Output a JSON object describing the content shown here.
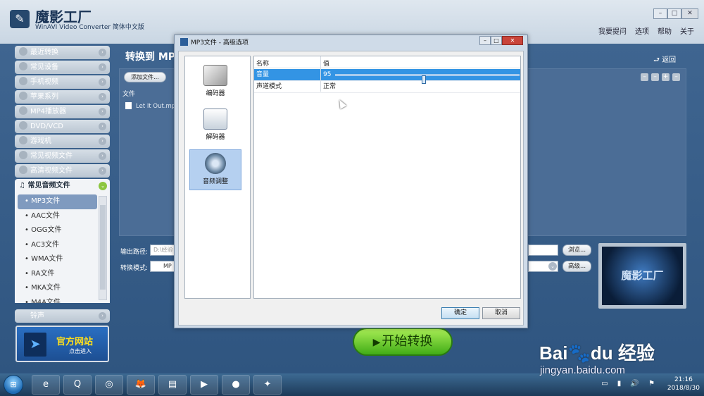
{
  "app": {
    "title": "魔影工厂",
    "subtitle": "WinAVI Video Converter 简体中文版",
    "window_buttons": [
      "–",
      "□",
      "✕"
    ],
    "top_links": [
      "我要提问",
      "选项",
      "帮助",
      "关于"
    ]
  },
  "sidebar": {
    "items": [
      {
        "label": "最近转换"
      },
      {
        "label": "常见设备"
      },
      {
        "label": "手机视频"
      },
      {
        "label": "苹果系列"
      },
      {
        "label": "MP4播放器"
      },
      {
        "label": "DVD/VCD"
      },
      {
        "label": "游戏机"
      },
      {
        "label": "常见视频文件"
      },
      {
        "label": "高清视频文件"
      }
    ],
    "open_category": "常见音频文件",
    "sub_items": [
      "• MP3文件",
      "• AAC文件",
      "• OGG文件",
      "• AC3文件",
      "• WMA文件",
      "• RA文件",
      "• MKA文件",
      "• M4A文件"
    ],
    "selected_sub_index": 0,
    "ring_label": "铃声",
    "official": {
      "title": "官方网站",
      "subtitle": "点击进入"
    }
  },
  "main": {
    "title": "转换到 MP",
    "back_label": "返回",
    "add_file_label": "添加文件...",
    "file_column": "文件",
    "file_name": "Let It Out.mp",
    "mini_buttons": [
      "–",
      "–",
      "+",
      "–"
    ],
    "output_label": "输出路径:",
    "output_value": "D:\\经验",
    "mode_label": "转换模式:",
    "mode_value": "MP",
    "browse_label": "浏览...",
    "advanced_label": "高级...",
    "preview_logo": "魔影工厂",
    "start_label": "开始转换"
  },
  "dialog": {
    "title": "MP3文件 - 高级选项",
    "title_buttons": [
      "–",
      "□",
      "✕"
    ],
    "left_items": [
      {
        "label": "编码器",
        "icon": "encoder-icon"
      },
      {
        "label": "解码器",
        "icon": "decoder-icon"
      },
      {
        "label": "音频调整",
        "icon": "speaker-icon"
      }
    ],
    "selected_left_index": 2,
    "columns": {
      "name": "名称",
      "value": "值"
    },
    "rows": [
      {
        "name": "音量",
        "value": "95"
      },
      {
        "name": "声道模式",
        "value": "正常"
      }
    ],
    "volume_level_fraction": 0.48,
    "ok_label": "确定",
    "cancel_label": "取消"
  },
  "taskbar": {
    "apps": [
      "e",
      "Q",
      "◎",
      "🦊",
      "▤",
      "▶",
      "●",
      "✦"
    ],
    "time": "21:16",
    "date": "2018/8/30",
    "tray_icons": "▭ ▮ 🔊 ⚑"
  },
  "watermark": {
    "brand": "Bai🐾du 经验",
    "url": "jingyan.baidu.com"
  },
  "colors": {
    "accent_selection": "#3394e4",
    "start_button": "#41ad17",
    "app_background": "#3f6590"
  }
}
